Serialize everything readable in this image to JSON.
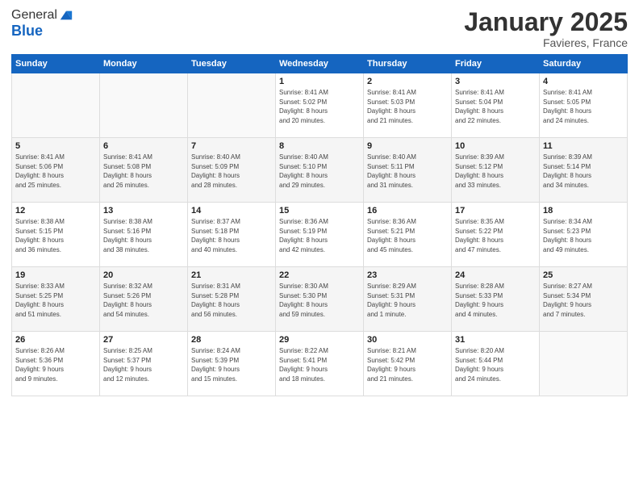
{
  "logo": {
    "general": "General",
    "blue": "Blue"
  },
  "header": {
    "month": "January 2025",
    "location": "Favieres, France"
  },
  "weekdays": [
    "Sunday",
    "Monday",
    "Tuesday",
    "Wednesday",
    "Thursday",
    "Friday",
    "Saturday"
  ],
  "weeks": [
    [
      {
        "day": "",
        "info": ""
      },
      {
        "day": "",
        "info": ""
      },
      {
        "day": "",
        "info": ""
      },
      {
        "day": "1",
        "info": "Sunrise: 8:41 AM\nSunset: 5:02 PM\nDaylight: 8 hours\nand 20 minutes."
      },
      {
        "day": "2",
        "info": "Sunrise: 8:41 AM\nSunset: 5:03 PM\nDaylight: 8 hours\nand 21 minutes."
      },
      {
        "day": "3",
        "info": "Sunrise: 8:41 AM\nSunset: 5:04 PM\nDaylight: 8 hours\nand 22 minutes."
      },
      {
        "day": "4",
        "info": "Sunrise: 8:41 AM\nSunset: 5:05 PM\nDaylight: 8 hours\nand 24 minutes."
      }
    ],
    [
      {
        "day": "5",
        "info": "Sunrise: 8:41 AM\nSunset: 5:06 PM\nDaylight: 8 hours\nand 25 minutes."
      },
      {
        "day": "6",
        "info": "Sunrise: 8:41 AM\nSunset: 5:08 PM\nDaylight: 8 hours\nand 26 minutes."
      },
      {
        "day": "7",
        "info": "Sunrise: 8:40 AM\nSunset: 5:09 PM\nDaylight: 8 hours\nand 28 minutes."
      },
      {
        "day": "8",
        "info": "Sunrise: 8:40 AM\nSunset: 5:10 PM\nDaylight: 8 hours\nand 29 minutes."
      },
      {
        "day": "9",
        "info": "Sunrise: 8:40 AM\nSunset: 5:11 PM\nDaylight: 8 hours\nand 31 minutes."
      },
      {
        "day": "10",
        "info": "Sunrise: 8:39 AM\nSunset: 5:12 PM\nDaylight: 8 hours\nand 33 minutes."
      },
      {
        "day": "11",
        "info": "Sunrise: 8:39 AM\nSunset: 5:14 PM\nDaylight: 8 hours\nand 34 minutes."
      }
    ],
    [
      {
        "day": "12",
        "info": "Sunrise: 8:38 AM\nSunset: 5:15 PM\nDaylight: 8 hours\nand 36 minutes."
      },
      {
        "day": "13",
        "info": "Sunrise: 8:38 AM\nSunset: 5:16 PM\nDaylight: 8 hours\nand 38 minutes."
      },
      {
        "day": "14",
        "info": "Sunrise: 8:37 AM\nSunset: 5:18 PM\nDaylight: 8 hours\nand 40 minutes."
      },
      {
        "day": "15",
        "info": "Sunrise: 8:36 AM\nSunset: 5:19 PM\nDaylight: 8 hours\nand 42 minutes."
      },
      {
        "day": "16",
        "info": "Sunrise: 8:36 AM\nSunset: 5:21 PM\nDaylight: 8 hours\nand 45 minutes."
      },
      {
        "day": "17",
        "info": "Sunrise: 8:35 AM\nSunset: 5:22 PM\nDaylight: 8 hours\nand 47 minutes."
      },
      {
        "day": "18",
        "info": "Sunrise: 8:34 AM\nSunset: 5:23 PM\nDaylight: 8 hours\nand 49 minutes."
      }
    ],
    [
      {
        "day": "19",
        "info": "Sunrise: 8:33 AM\nSunset: 5:25 PM\nDaylight: 8 hours\nand 51 minutes."
      },
      {
        "day": "20",
        "info": "Sunrise: 8:32 AM\nSunset: 5:26 PM\nDaylight: 8 hours\nand 54 minutes."
      },
      {
        "day": "21",
        "info": "Sunrise: 8:31 AM\nSunset: 5:28 PM\nDaylight: 8 hours\nand 56 minutes."
      },
      {
        "day": "22",
        "info": "Sunrise: 8:30 AM\nSunset: 5:30 PM\nDaylight: 8 hours\nand 59 minutes."
      },
      {
        "day": "23",
        "info": "Sunrise: 8:29 AM\nSunset: 5:31 PM\nDaylight: 9 hours\nand 1 minute."
      },
      {
        "day": "24",
        "info": "Sunrise: 8:28 AM\nSunset: 5:33 PM\nDaylight: 9 hours\nand 4 minutes."
      },
      {
        "day": "25",
        "info": "Sunrise: 8:27 AM\nSunset: 5:34 PM\nDaylight: 9 hours\nand 7 minutes."
      }
    ],
    [
      {
        "day": "26",
        "info": "Sunrise: 8:26 AM\nSunset: 5:36 PM\nDaylight: 9 hours\nand 9 minutes."
      },
      {
        "day": "27",
        "info": "Sunrise: 8:25 AM\nSunset: 5:37 PM\nDaylight: 9 hours\nand 12 minutes."
      },
      {
        "day": "28",
        "info": "Sunrise: 8:24 AM\nSunset: 5:39 PM\nDaylight: 9 hours\nand 15 minutes."
      },
      {
        "day": "29",
        "info": "Sunrise: 8:22 AM\nSunset: 5:41 PM\nDaylight: 9 hours\nand 18 minutes."
      },
      {
        "day": "30",
        "info": "Sunrise: 8:21 AM\nSunset: 5:42 PM\nDaylight: 9 hours\nand 21 minutes."
      },
      {
        "day": "31",
        "info": "Sunrise: 8:20 AM\nSunset: 5:44 PM\nDaylight: 9 hours\nand 24 minutes."
      },
      {
        "day": "",
        "info": ""
      }
    ]
  ]
}
